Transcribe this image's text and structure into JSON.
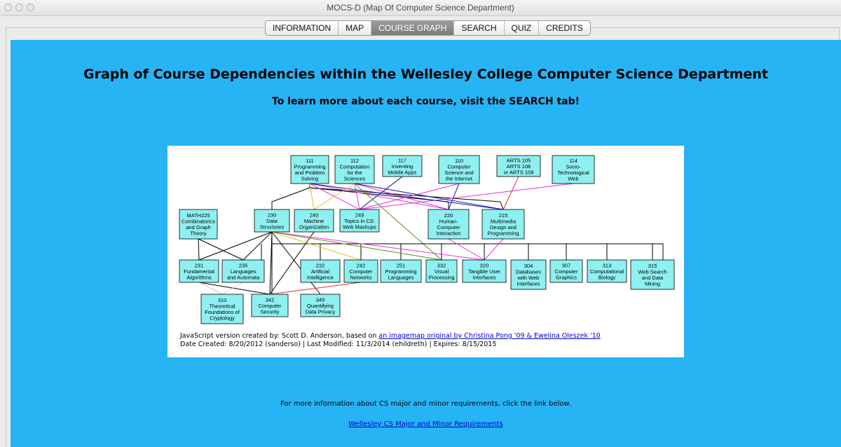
{
  "window": {
    "title": "MOCS-D (Map Of Computer Science Department)"
  },
  "tabs": [
    {
      "label": "INFORMATION"
    },
    {
      "label": "MAP"
    },
    {
      "label": "COURSE GRAPH",
      "active": true
    },
    {
      "label": "SEARCH"
    },
    {
      "label": "QUIZ"
    },
    {
      "label": "CREDITS"
    }
  ],
  "page": {
    "heading": "Graph of Course Dependencies within the Wellesley College Computer Science Department",
    "subheading": "To learn more about each course, visit the SEARCH tab!",
    "background_color": "#27b4f5"
  },
  "graph": {
    "nodes": [
      {
        "id": "111",
        "lines": [
          "111",
          "Programming",
          "and Problem",
          "Solving"
        ]
      },
      {
        "id": "112",
        "lines": [
          "112",
          "Computation",
          "for the",
          "Sciences"
        ]
      },
      {
        "id": "117",
        "lines": [
          "117",
          "Inventing",
          "Mobile Apps"
        ]
      },
      {
        "id": "110",
        "lines": [
          "110",
          "Computer",
          "Science and",
          "the Internet"
        ]
      },
      {
        "id": "arts",
        "lines": [
          "ARTS 105",
          "ARTS 108",
          "or ARTS 109"
        ]
      },
      {
        "id": "114",
        "lines": [
          "114",
          "Socio-",
          "Technological",
          "Web"
        ]
      },
      {
        "id": "math225",
        "lines": [
          "MATH225",
          "Combinatorics",
          "and Graph",
          "Theory"
        ]
      },
      {
        "id": "230",
        "lines": [
          "230",
          "Data",
          "Structures"
        ]
      },
      {
        "id": "240",
        "lines": [
          "240",
          "Machine",
          "Organization"
        ]
      },
      {
        "id": "249",
        "lines": [
          "249",
          "Topics in CS:",
          "Web Mashups"
        ]
      },
      {
        "id": "220",
        "lines": [
          "220",
          "Human-",
          "Computer",
          "Interaction"
        ]
      },
      {
        "id": "215",
        "lines": [
          "215",
          "Multimedia",
          "Design and",
          "Programming"
        ]
      },
      {
        "id": "231",
        "lines": [
          "231",
          "Fundamental",
          "Algorithms"
        ]
      },
      {
        "id": "235",
        "lines": [
          "235",
          "Languages",
          "and Automata"
        ]
      },
      {
        "id": "232",
        "lines": [
          "232",
          "Artificial",
          "Intelligence"
        ]
      },
      {
        "id": "242",
        "lines": [
          "242",
          "Computer",
          "Networks"
        ]
      },
      {
        "id": "251",
        "lines": [
          "251",
          "Programming",
          "Languages"
        ]
      },
      {
        "id": "332",
        "lines": [
          "332",
          "Visual",
          "Processing"
        ]
      },
      {
        "id": "320",
        "lines": [
          "320",
          "Tangible User",
          "Interfaces"
        ]
      },
      {
        "id": "304",
        "lines": [
          "304",
          "Databases",
          "with Web",
          "Interfaces"
        ]
      },
      {
        "id": "307",
        "lines": [
          "307",
          "Computer",
          "Graphics"
        ]
      },
      {
        "id": "313",
        "lines": [
          "313",
          "Computational",
          "Biology"
        ]
      },
      {
        "id": "315",
        "lines": [
          "315",
          "Web Search",
          "and Data",
          "Mining"
        ]
      },
      {
        "id": "310",
        "lines": [
          "310",
          "Theoretical",
          "Foundations of",
          "Cryptology"
        ]
      },
      {
        "id": "342",
        "lines": [
          "342",
          "Computer",
          "Security"
        ]
      },
      {
        "id": "349",
        "lines": [
          "349",
          "Quantifying",
          "Data Privacy"
        ]
      }
    ],
    "edge_colors": {
      "black": "#000000",
      "magenta": "#e233e2",
      "navy": "#1a1aa0",
      "olive": "#5a8a1a",
      "yellow": "#e0c21a",
      "red": "#e03030",
      "pink": "#f4b8c8"
    }
  },
  "credits": {
    "line1_prefix": "JavaScript version created by: Scott D. Anderson, based on ",
    "line1_link": "an imagemap original by Christina Pong '09 & Ewelina Oleszek '10",
    "line2": "Date Created: 8/20/2012 (sanderso) | Last Modified: 11/3/2014 (ehildreth) | Expires: 8/15/2015"
  },
  "footer": {
    "info": "For more information about CS major and minor requirements, click the link below.",
    "link": "Wellesley CS Major and Minor Requirements"
  }
}
